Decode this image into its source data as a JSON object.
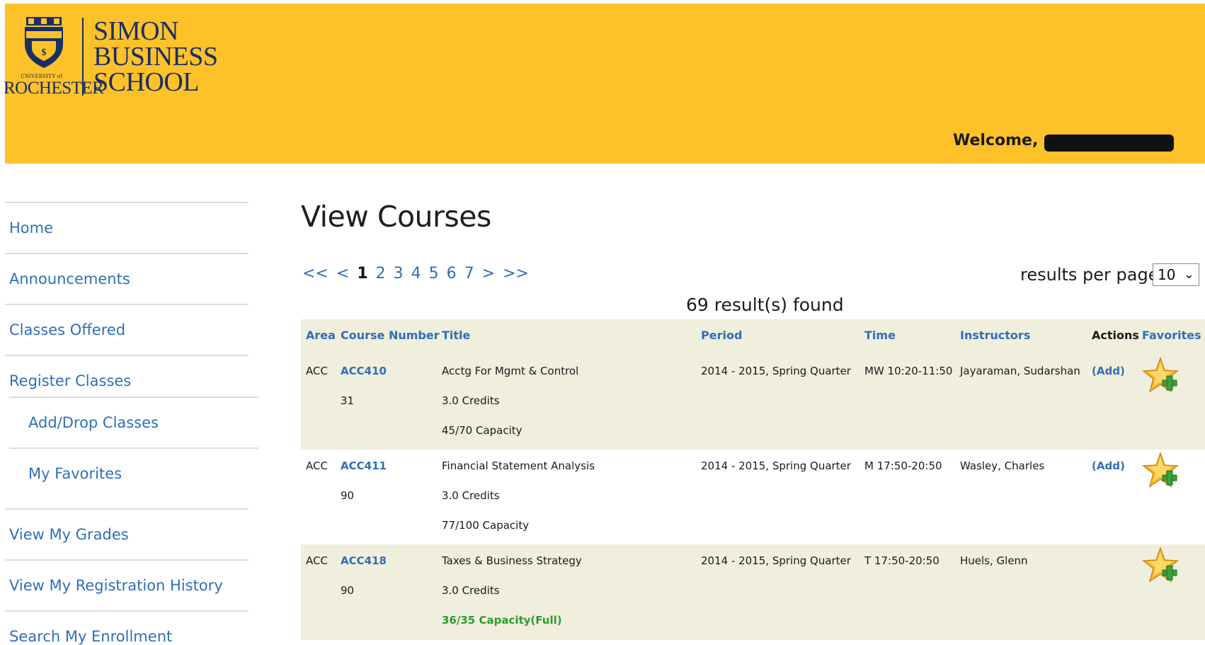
{
  "header": {
    "logo": {
      "univ_small": "UNIVERSITY of",
      "univ_big": "ROCHESTER",
      "school_lines": [
        "SIMON",
        "BUSINESS",
        "SCHOOL"
      ],
      "crest_text": "MELIORA"
    },
    "welcome": "Welcome,",
    "colors": {
      "header_bg": "#fdc12a",
      "logo_navy": "#1a2e63"
    }
  },
  "sidebar": {
    "items": [
      {
        "label": "Home"
      },
      {
        "label": "Announcements"
      },
      {
        "label": "Classes Offered"
      },
      {
        "label": "Register Classes"
      },
      {
        "label": "Add/Drop Classes"
      },
      {
        "label": "My Favorites"
      },
      {
        "label": "View My Grades"
      },
      {
        "label": "View My Registration History"
      },
      {
        "label": "Search My Enrollment"
      }
    ]
  },
  "main": {
    "title": "View Courses",
    "pager": {
      "first": "<<",
      "prev": "<",
      "pages": [
        "1",
        "2",
        "3",
        "4",
        "5",
        "6",
        "7"
      ],
      "current": "1",
      "next": ">",
      "last": ">>"
    },
    "results_per_page_label": "results per page:",
    "results_per_page_value": "10",
    "results_found": "69 result(s) found"
  },
  "table": {
    "columns": [
      "Area",
      "Course Number",
      "Title",
      "Period",
      "Time",
      "Instructors",
      "Actions",
      "Favorites"
    ],
    "rows": [
      {
        "area": "ACC",
        "course": "ACC410",
        "section": "31",
        "title": "Acctg For Mgmt & Control",
        "credits": "3.0 Credits",
        "capacity": "45/70 Capacity",
        "period": "2014 - 2015, Spring Quarter",
        "time": "MW 10:20-11:50",
        "instructors": "Jayaraman, Sudarshan",
        "action": "(Add)",
        "favorite_icon": "star-add-icon"
      },
      {
        "area": "ACC",
        "course": "ACC411",
        "section": "90",
        "title": "Financial Statement Analysis",
        "credits": "3.0 Credits",
        "capacity": "77/100 Capacity",
        "period": "2014 - 2015, Spring Quarter",
        "time": "M 17:50-20:50",
        "instructors": "Wasley, Charles",
        "action": "(Add)",
        "favorite_icon": "star-add-icon"
      },
      {
        "area": "ACC",
        "course": "ACC418",
        "section": "90",
        "title": "Taxes & Business Strategy",
        "credits": "3.0 Credits",
        "capacity": "36/35 Capacity(Full)",
        "period": "2014 - 2015, Spring Quarter",
        "time": "T 17:50-20:50",
        "instructors": "Huels, Glenn",
        "action": "",
        "favorite_icon": "star-add-icon"
      }
    ]
  }
}
